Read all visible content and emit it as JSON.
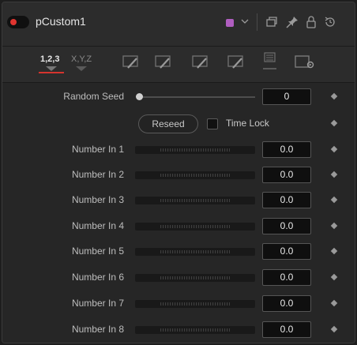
{
  "header": {
    "tool_name": "pCustom1",
    "swatch_color": "#b05ec0",
    "enable_color": "#e0342f"
  },
  "tabs": [
    {
      "label": "1,2,3",
      "icon": "numbers-tab",
      "active": true
    },
    {
      "label": "X,Y,Z",
      "icon": "position-tab",
      "active": false
    },
    {
      "label": "",
      "icon": "expression-tab-1",
      "active": false
    },
    {
      "label": "",
      "icon": "expression-tab-2",
      "active": false
    },
    {
      "label": "",
      "icon": "expression-tab-3",
      "active": false
    },
    {
      "label": "",
      "icon": "expression-tab-4",
      "active": false
    },
    {
      "label": "",
      "icon": "image-tab",
      "active": false
    },
    {
      "label": "",
      "icon": "settings-tab",
      "active": false
    }
  ],
  "controls": {
    "random_seed_label": "Random Seed",
    "random_seed_value": "0",
    "reseed_label": "Reseed",
    "time_lock_label": "Time Lock",
    "time_lock_checked": false
  },
  "numbers": [
    {
      "label": "Number In 1",
      "value": "0.0"
    },
    {
      "label": "Number In 2",
      "value": "0.0"
    },
    {
      "label": "Number In 3",
      "value": "0.0"
    },
    {
      "label": "Number In 4",
      "value": "0.0"
    },
    {
      "label": "Number In 5",
      "value": "0.0"
    },
    {
      "label": "Number In 6",
      "value": "0.0"
    },
    {
      "label": "Number In 7",
      "value": "0.0"
    },
    {
      "label": "Number In 8",
      "value": "0.0"
    }
  ]
}
